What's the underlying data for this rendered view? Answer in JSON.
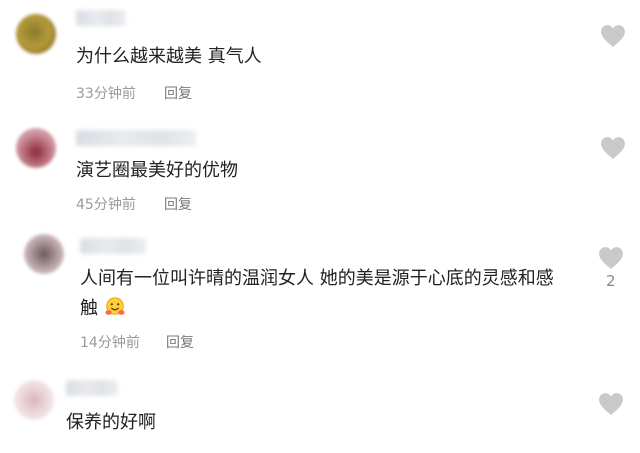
{
  "comments": [
    {
      "text": "为什么越来越美 真气人",
      "time": "33分钟前",
      "reply_label": "回复",
      "likes": ""
    },
    {
      "text": "演艺圈最美好的优物",
      "time": "45分钟前",
      "reply_label": "回复",
      "likes": ""
    },
    {
      "text_line1": "人间有一位叫许晴的温润女人 她的美是源于心底的灵感和感",
      "text_line2": "触",
      "time": "14分钟前",
      "reply_label": "回复",
      "likes": "2"
    },
    {
      "text": "保养的好啊",
      "time": "",
      "reply_label": "",
      "likes": ""
    }
  ],
  "icons": {
    "like": "heart-icon",
    "emoji": "hugging-face-emoji"
  },
  "colors": {
    "heart": "#c9c9c9",
    "meta_text": "#9a9a9a"
  }
}
